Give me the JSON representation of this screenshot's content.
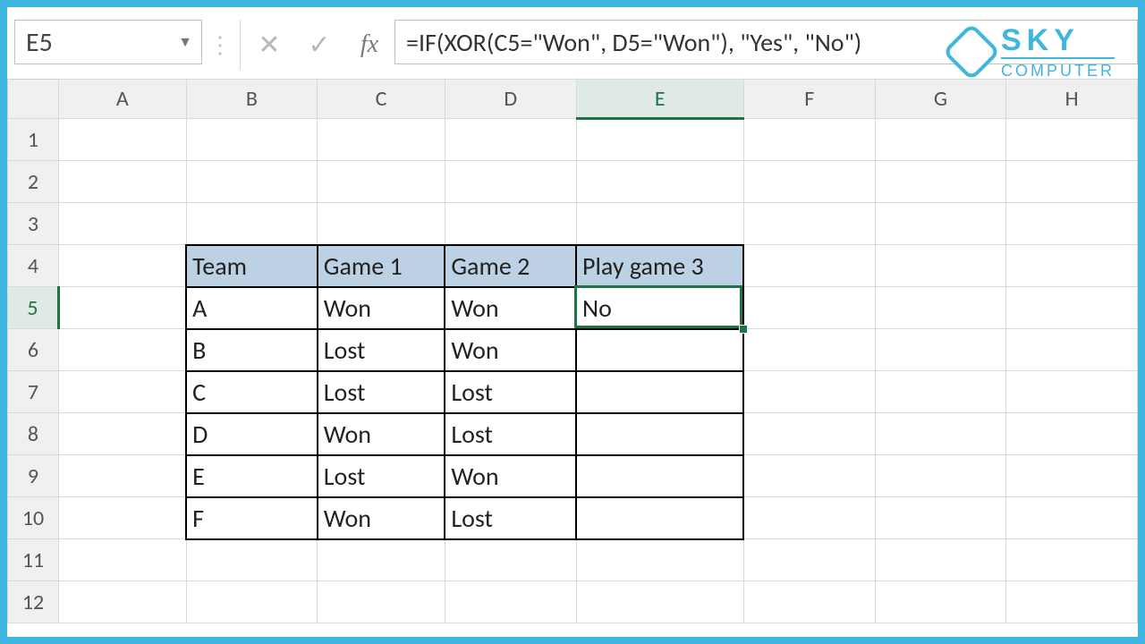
{
  "active_cell_ref": "E5",
  "formula": "=IF(XOR(C5=\"Won\", D5=\"Won\"), \"Yes\", \"No\")",
  "columns": [
    "A",
    "B",
    "C",
    "D",
    "E",
    "F",
    "G",
    "H"
  ],
  "rows": [
    "1",
    "2",
    "3",
    "4",
    "5",
    "6",
    "7",
    "8",
    "9",
    "10",
    "11",
    "12"
  ],
  "selected_column": "E",
  "selected_row": "5",
  "table": {
    "headers": {
      "team": "Team",
      "g1": "Game 1",
      "g2": "Game 2",
      "pg3": "Play game 3"
    },
    "rows": [
      {
        "team": "A",
        "g1": "Won",
        "g2": "Won",
        "pg3": "No"
      },
      {
        "team": "B",
        "g1": "Lost",
        "g2": "Won",
        "pg3": ""
      },
      {
        "team": "C",
        "g1": "Lost",
        "g2": "Lost",
        "pg3": ""
      },
      {
        "team": "D",
        "g1": "Won",
        "g2": "Lost",
        "pg3": ""
      },
      {
        "team": "E",
        "g1": "Lost",
        "g2": "Won",
        "pg3": ""
      },
      {
        "team": "F",
        "g1": "Won",
        "g2": "Lost",
        "pg3": ""
      }
    ]
  },
  "logo": {
    "line1": "SKY",
    "line2": "COMPUTER"
  }
}
